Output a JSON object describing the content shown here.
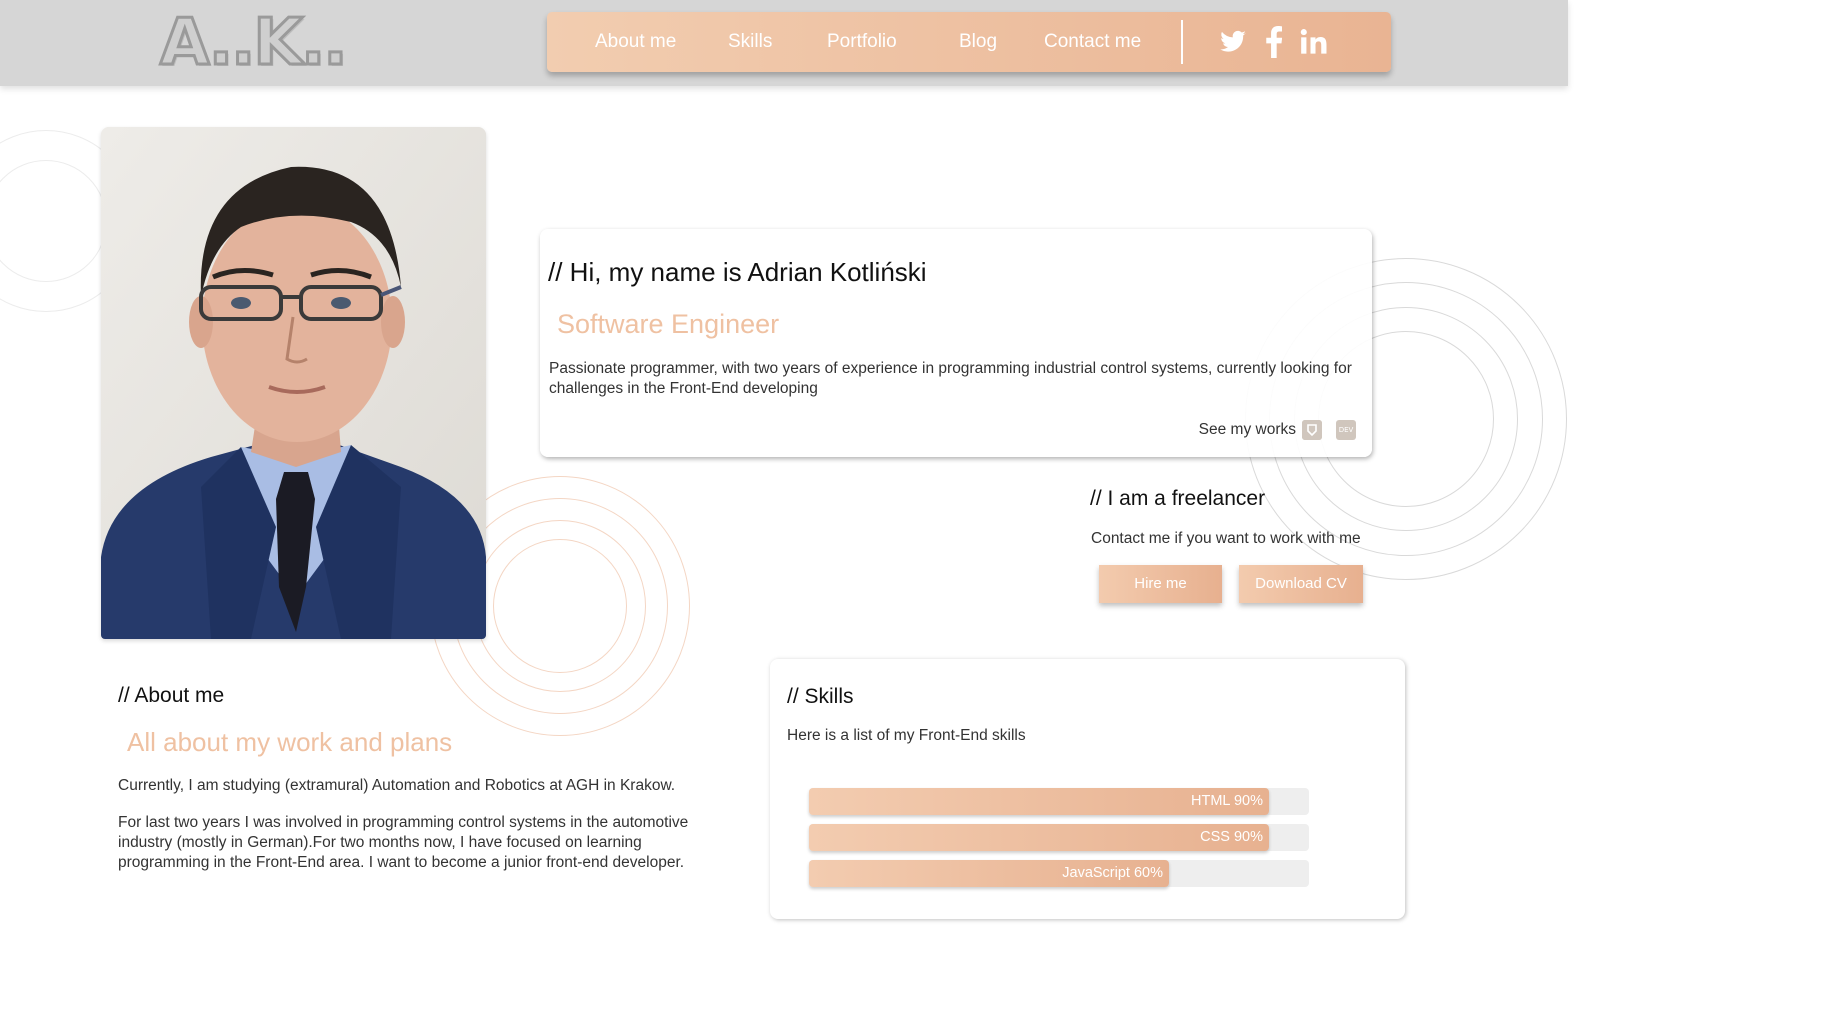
{
  "header": {
    "logo_text": "A..K..",
    "nav": [
      {
        "label": "About me"
      },
      {
        "label": "Skills"
      },
      {
        "label": "Portfolio"
      },
      {
        "label": "Blog"
      },
      {
        "label": "Contact me"
      }
    ],
    "social": [
      "twitter-icon",
      "facebook-icon",
      "linkedin-icon"
    ]
  },
  "hero": {
    "title": "// Hi, my name is Adrian Kotliński",
    "subtitle": "Software Engineer",
    "description": "Passionate programmer, with two years of experience in programming industrial control systems, currently looking for challenges in the Front-End developing",
    "see_works": "See my works",
    "works_icons": [
      "freecodecamp-icon",
      "dev-icon"
    ],
    "dev_icon_text": "DEV"
  },
  "freelancer": {
    "title": "// I am a freelancer",
    "text": "Contact me if you want to work with me",
    "hire_label": "Hire me",
    "cv_label": "Download CV"
  },
  "about": {
    "title": "// About me",
    "subtitle": "All about my work and plans",
    "p1": "Currently, I am studying (extramural) Automation and Robotics at AGH in Krakow.",
    "p2": "For last two years I was involved in programming control systems in the automotive industry (mostly in German).For two months now, I have focused on learning programming in the Front-End area. I want to become a junior front-end developer."
  },
  "skills": {
    "title": "// Skills",
    "text": "Here is a list of my Front-End skills",
    "bars": [
      {
        "label": "HTML 90%",
        "value": 0.92
      },
      {
        "label": "CSS 90%",
        "value": 0.92
      },
      {
        "label": "JavaScript 60%",
        "value": 0.72
      }
    ]
  },
  "colors": {
    "accent": "#efc1a2",
    "nav_start": "#f2cdb0",
    "nav_end": "#e9b493",
    "header_bg": "#d6d6d6"
  }
}
